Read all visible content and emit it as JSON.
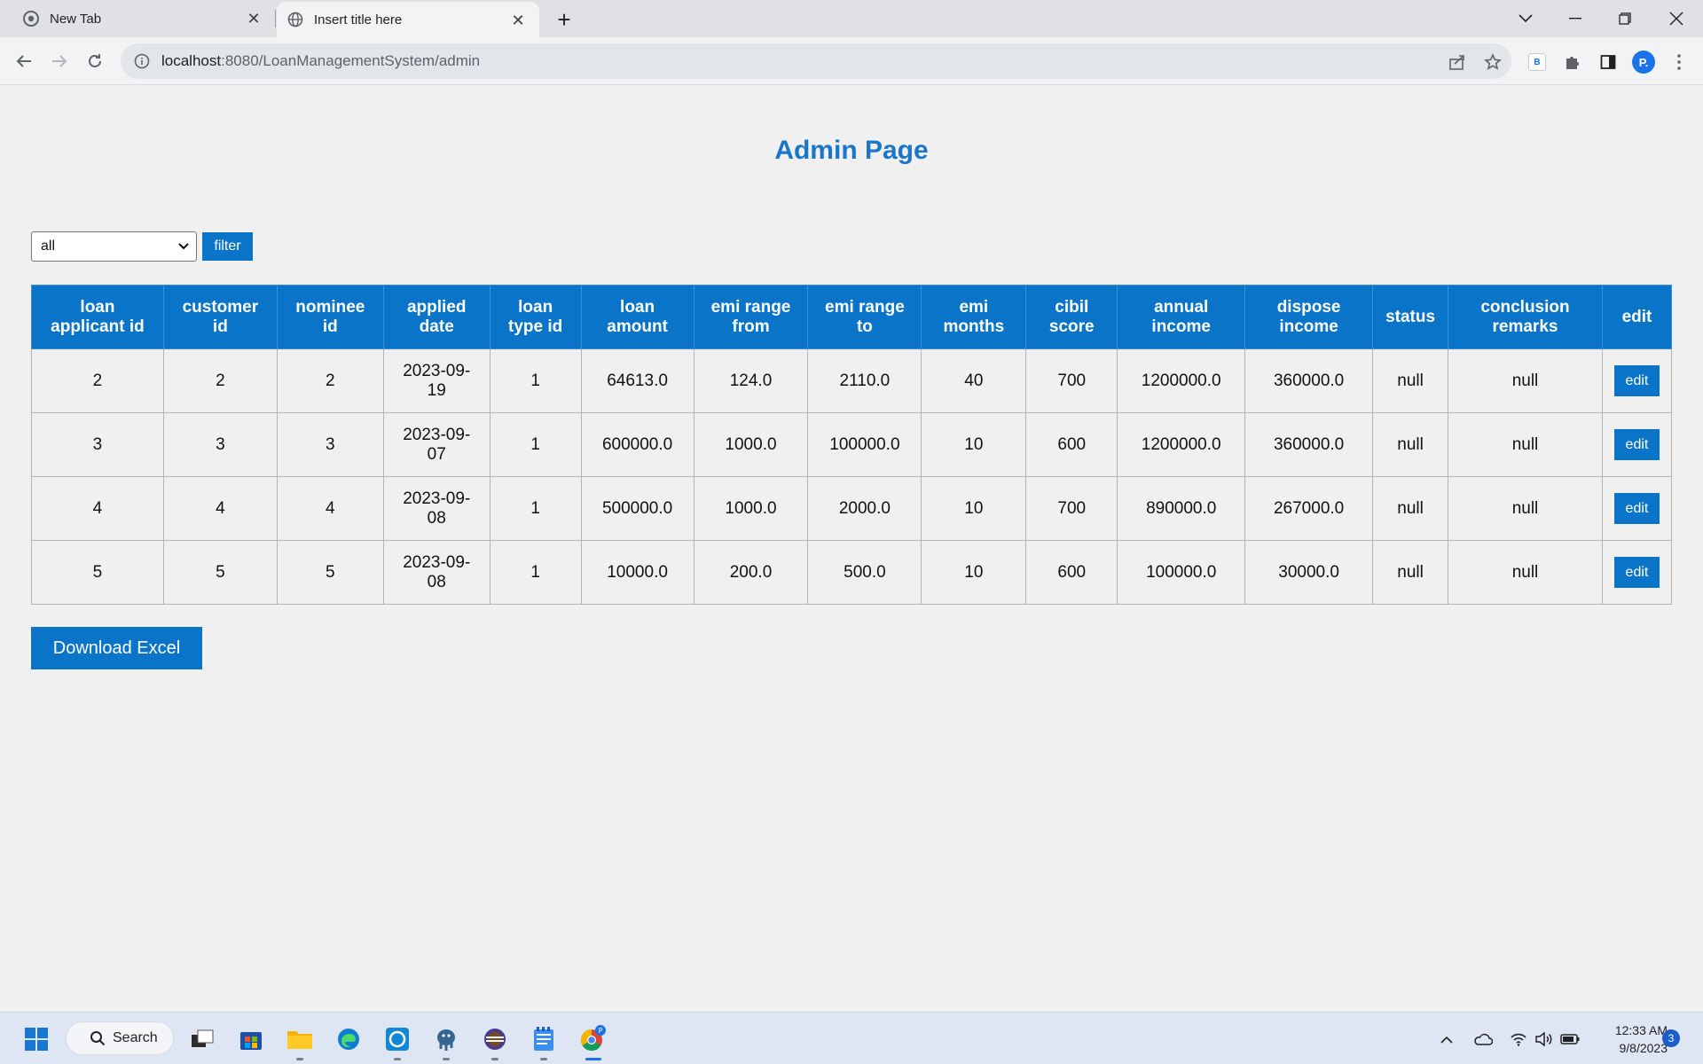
{
  "browser": {
    "tabs": [
      {
        "title": "New Tab",
        "active": false
      },
      {
        "title": "Insert title here",
        "active": true
      }
    ],
    "url_host": "localhost",
    "url_path": ":8080/LoanManagementSystem/admin",
    "profile_initial": "P.",
    "extension_letter": "B"
  },
  "page": {
    "title": "Admin Page",
    "filter": {
      "selected": "all",
      "button_label": "filter"
    },
    "table": {
      "headers": [
        [
          "loan",
          "applicant id"
        ],
        [
          "customer",
          "id"
        ],
        [
          "nominee",
          "id"
        ],
        [
          "applied",
          "date"
        ],
        [
          "loan",
          "type id"
        ],
        [
          "loan",
          "amount"
        ],
        [
          "emi range",
          "from"
        ],
        [
          "emi range",
          "to"
        ],
        [
          "emi",
          "months"
        ],
        [
          "cibil",
          "score"
        ],
        [
          "annual",
          "income"
        ],
        [
          "dispose",
          "income"
        ],
        [
          "status",
          ""
        ],
        [
          "conclusion",
          "remarks"
        ],
        [
          "edit",
          ""
        ]
      ],
      "rows": [
        {
          "cells": [
            "2",
            "2",
            "2",
            "2023-09-19",
            "1",
            "64613.0",
            "124.0",
            "2110.0",
            "40",
            "700",
            "1200000.0",
            "360000.0",
            "null",
            "null"
          ]
        },
        {
          "cells": [
            "3",
            "3",
            "3",
            "2023-09-07",
            "1",
            "600000.0",
            "1000.0",
            "100000.0",
            "10",
            "600",
            "1200000.0",
            "360000.0",
            "null",
            "null"
          ]
        },
        {
          "cells": [
            "4",
            "4",
            "4",
            "2023-09-08",
            "1",
            "500000.0",
            "1000.0",
            "2000.0",
            "10",
            "700",
            "890000.0",
            "267000.0",
            "null",
            "null"
          ]
        },
        {
          "cells": [
            "5",
            "5",
            "5",
            "2023-09-08",
            "1",
            "10000.0",
            "200.0",
            "500.0",
            "10",
            "600",
            "100000.0",
            "30000.0",
            "null",
            "null"
          ]
        }
      ],
      "edit_label": "edit"
    },
    "download_label": "Download Excel"
  },
  "taskbar": {
    "search_label": "Search",
    "time": "12:33 AM",
    "date": "9/8/2023",
    "notification_count": "3",
    "chrome_badge": "P"
  }
}
